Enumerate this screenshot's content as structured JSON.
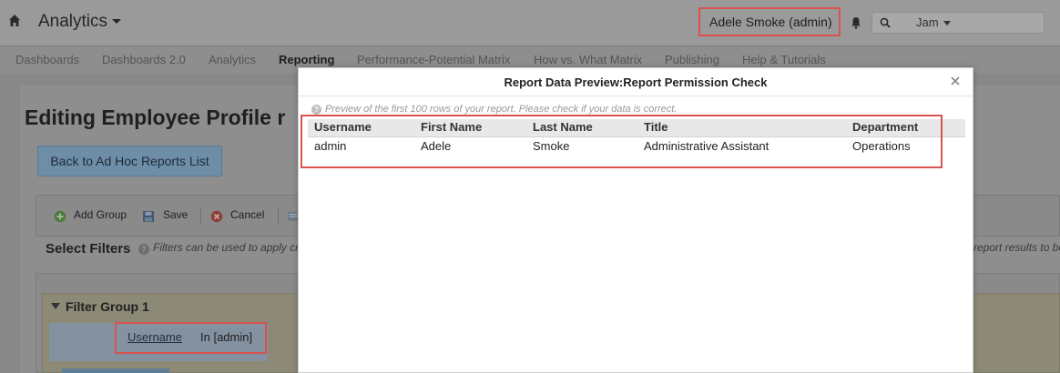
{
  "header": {
    "app_title": "Analytics",
    "user_name": "Adele Smoke (admin)",
    "search_placeholder": "",
    "jam_label": "Jam"
  },
  "nav": {
    "items": [
      "Dashboards",
      "Dashboards 2.0",
      "Analytics",
      "Reporting",
      "Performance-Potential Matrix",
      "How vs. What Matrix",
      "Publishing",
      "Help & Tutorials"
    ],
    "active": "Reporting"
  },
  "page": {
    "title": "Editing Employee Profile r",
    "back_button": "Back to Ad Hoc Reports List",
    "toolbar": {
      "add_group": "Add Group",
      "save": "Save",
      "cancel": "Cancel"
    },
    "filters_title": "Select Filters",
    "filters_desc": "Filters can be used to apply cri",
    "filters_desc_right": "report results to be",
    "filter_group": {
      "title": "Filter Group 1",
      "field": "Username",
      "value": "In [admin]"
    }
  },
  "modal": {
    "title": "Report Data Preview:Report Permission Check",
    "note": "Preview of the first 100 rows of your report. Please check if your data is correct.",
    "columns": [
      "Username",
      "First Name",
      "Last Name",
      "Title",
      "Department"
    ],
    "rows": [
      [
        "admin",
        "Adele",
        "Smoke",
        "Administrative Assistant",
        "Operations"
      ]
    ]
  },
  "colors": {
    "highlight": "#d9534f",
    "overlay": "#8f8f8f",
    "modal_bg": "#ffffff"
  }
}
